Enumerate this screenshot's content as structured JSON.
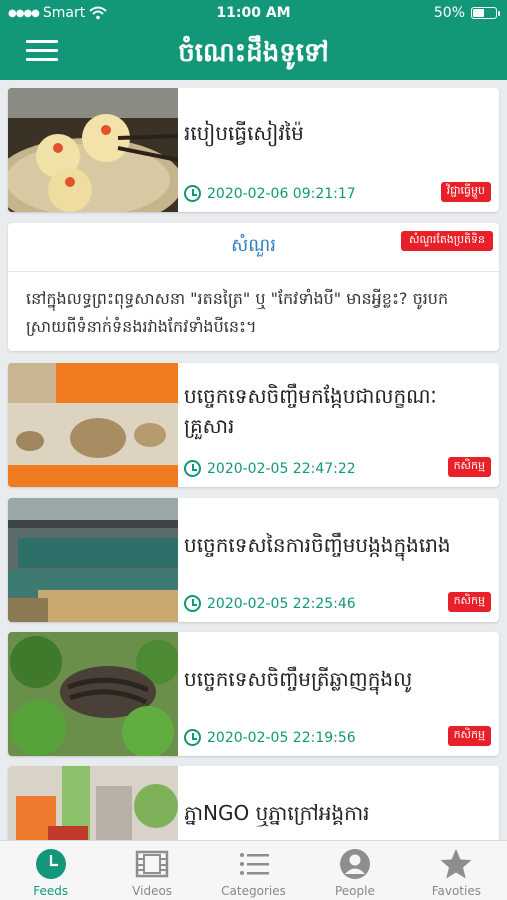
{
  "status": {
    "carrier": "Smart",
    "time": "11:00 AM",
    "battery": "50%",
    "battery_level": 0.5
  },
  "header": {
    "title": "ចំណេះដឹងទូទៅ"
  },
  "feed": {
    "items": [
      {
        "title": "របៀបធ្វើសៀវម៉ៃ",
        "time": "2020-02-06 09:21:17",
        "tag": "វិជ្ជាធ្វើម្ហូប",
        "image": "dumplings-photo"
      },
      {
        "title": "បច្ចេកទេសចិញ្ចឹមកង្កែបជាលក្ខណៈគ្រួសារ",
        "time": "2020-02-05 22:47:22",
        "tag": "កសិកម្ម",
        "image": "frog-book-photo"
      },
      {
        "title": "បច្ចេកទេសនៃការចិញ្ចឹមបង្កងក្នុងរោង",
        "time": "2020-02-05 22:25:46",
        "tag": "កសិកម្ម",
        "image": "tanks-photo"
      },
      {
        "title": "បច្ចេកទេសចិញ្ចឹមត្រីឆ្លាញក្នុងលូ",
        "time": "2020-02-05 22:19:56",
        "tag": "កសិកម្ម",
        "image": "eel-photo"
      },
      {
        "title": "ភ្នាNGO ឬភ្នាក្រៅអង្គការ",
        "image": "food-photo"
      }
    ],
    "question": {
      "label": "សំណួរ",
      "tag": "សំណួរតែងប្រតិទិន",
      "text": "នៅក្នុងលទ្ធព្រះពុទ្ធសាសនា \"រតនត្រៃ\" ឬ \"កែវទាំងបី\" មានអ្វីខ្លះ? ចូរបកស្រាយពីទំនាក់ទំនងរវាងកែវទាំងបីនេះ។"
    }
  },
  "tabs": [
    {
      "label": "Feeds",
      "icon": "clock-icon",
      "active": true
    },
    {
      "label": "Videos",
      "icon": "film-icon",
      "active": false
    },
    {
      "label": "Categories",
      "icon": "list-icon",
      "active": false
    },
    {
      "label": "People",
      "icon": "person-icon",
      "active": false
    },
    {
      "label": "Favoties",
      "icon": "star-icon",
      "active": false
    }
  ],
  "colors": {
    "primary": "#139779",
    "tag": "#e8202a",
    "question_label": "#2e7fc3"
  }
}
